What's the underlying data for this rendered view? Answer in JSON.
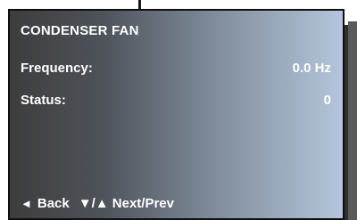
{
  "screen": {
    "title": "CONDENSER FAN",
    "rows": [
      {
        "label": "Frequency:",
        "value": "0.0 Hz"
      },
      {
        "label": "Status:",
        "value": "0"
      }
    ],
    "footer": {
      "back_icon": "◄",
      "back_label": "Back",
      "nav_icon": "▼/▲",
      "nav_label": "Next/Prev"
    }
  },
  "colors": {
    "panel_dark": "#3d3d3d",
    "panel_light": "#b4c6dc",
    "text": "#ffffff"
  }
}
